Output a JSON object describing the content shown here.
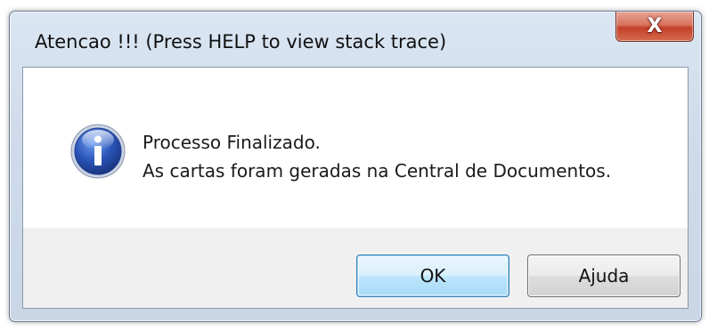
{
  "window": {
    "title": "Atencao !!!  (Press HELP to view stack trace)",
    "close_label": "X"
  },
  "dialog": {
    "icon": "info-icon",
    "message_line1": "Processo Finalizado.",
    "message_line2": "As cartas foram geradas na Central de Documentos."
  },
  "buttons": {
    "ok_label": "OK",
    "help_label": "Ajuda"
  },
  "colors": {
    "frame": "#cfdbea",
    "close_button": "#c4412a",
    "ok_button_border": "#3c7fb1",
    "icon_blue": "#2a54b8"
  }
}
